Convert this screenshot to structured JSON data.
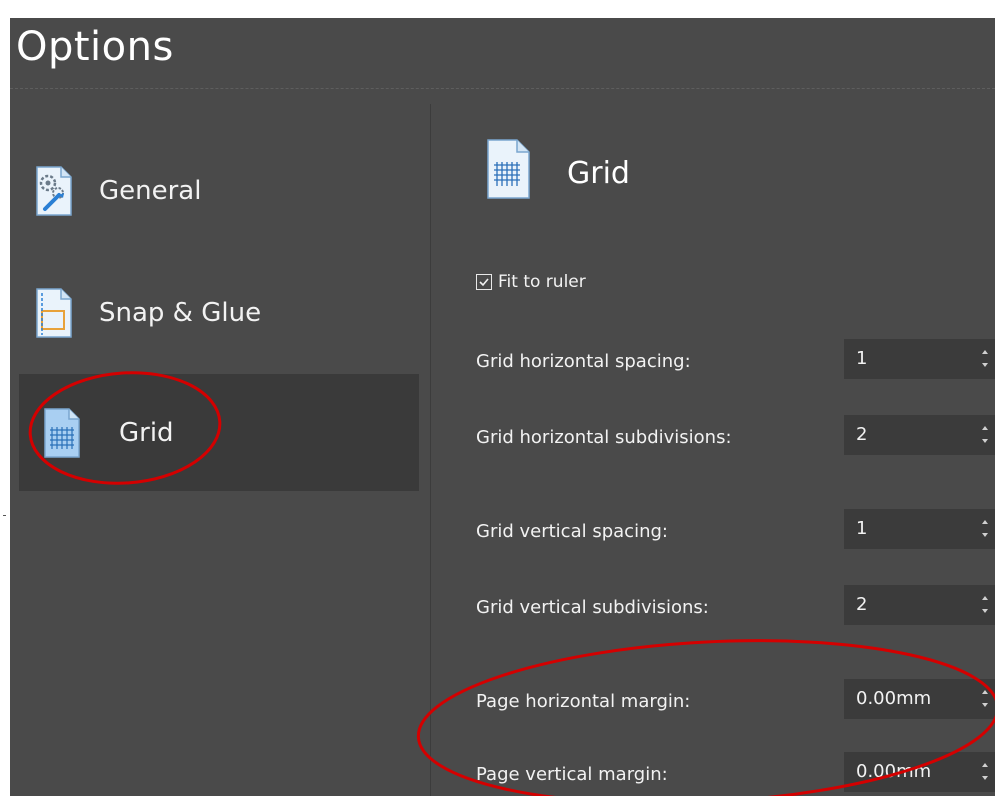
{
  "window": {
    "title": "Options"
  },
  "sidebar": {
    "items": [
      {
        "label": "General",
        "icon": "general-settings-icon"
      },
      {
        "label": "Snap & Glue",
        "icon": "snap-glue-icon"
      },
      {
        "label": "Grid",
        "icon": "grid-icon",
        "selected": true
      }
    ]
  },
  "main": {
    "section_title": "Grid",
    "section_icon": "grid-icon",
    "fit_to_ruler": {
      "label": "Fit to ruler",
      "checked": true
    },
    "fields": [
      {
        "label": "Grid horizontal spacing:",
        "value": "1"
      },
      {
        "label": "Grid horizontal subdivisions:",
        "value": "2"
      },
      {
        "label": "Grid vertical spacing:",
        "value": "1"
      },
      {
        "label": "Grid vertical subdivisions:",
        "value": "2"
      },
      {
        "label": "Page horizontal margin:",
        "value": "0.00mm"
      },
      {
        "label": "Page vertical margin:",
        "value": "0.00mm"
      }
    ]
  },
  "colors": {
    "background": "#4a4a4a",
    "selected_item": "#3a3a3a",
    "input_bg": "#3b3b3b",
    "annotation": "#d40000",
    "icon_accent": "#2a7fd4"
  }
}
